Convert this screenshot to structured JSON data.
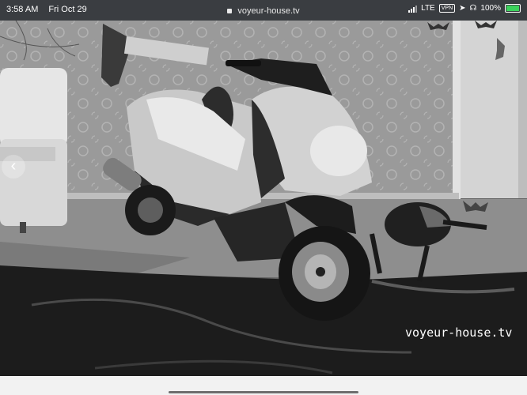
{
  "status_bar": {
    "time": "3:58 AM",
    "date": "Fri Oct 29",
    "network": "LTE",
    "vpn": "VPN",
    "battery_percent": "100%"
  },
  "address_bar": {
    "url": "voyeur-house.tv"
  },
  "video": {
    "watermark": "voyeur-house.tv"
  },
  "icons": {
    "signal": "signal-bars-icon",
    "location": "location-arrow-icon",
    "headphones": "headphones-icon",
    "lock": "lock-icon",
    "battery": "battery-charging-icon",
    "prev": "chevron-left-icon"
  },
  "colors": {
    "battery_fill": "#3bd15b",
    "status_bar_bg": "#3a3d41"
  }
}
